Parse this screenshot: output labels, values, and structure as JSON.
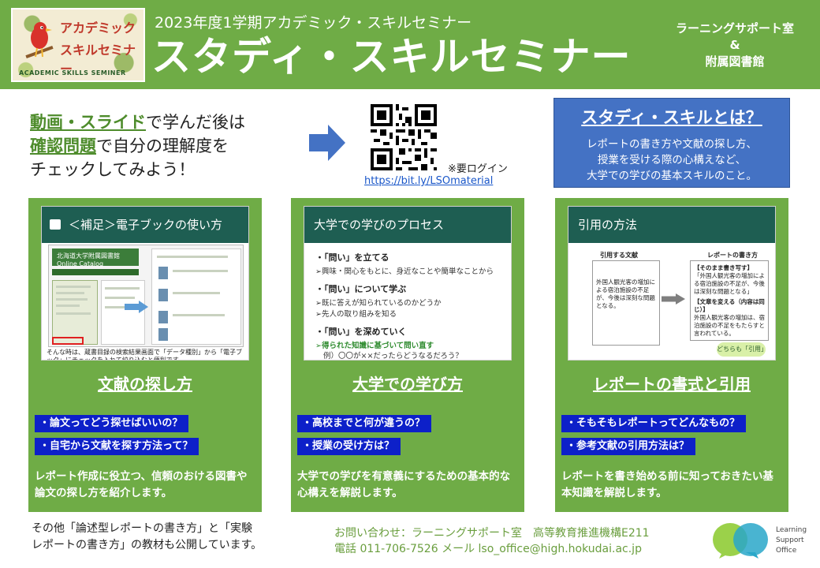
{
  "header": {
    "logo": {
      "line1": "アカデミック",
      "line2": "スキルセミナー",
      "line3": "ACADEMIC SKILLS SEMINER"
    },
    "subtitle": "2023年度1学期アカデミック・スキルセミナー",
    "title": "スタディ・スキルセミナー",
    "org_line1": "ラーニングサポート室",
    "org_line2": "&",
    "org_line3": "附属図書館"
  },
  "intro": {
    "l1_hl": "動画・スライド",
    "l1_rest": "で学んだ後は",
    "l2_hl": "確認問題",
    "l2_rest": "で自分の理解度を",
    "l3": "チェックしてみよう！"
  },
  "qr": {
    "note": "※要ログイン",
    "url": "https://bit.ly/LSOmaterial"
  },
  "what": {
    "title": "スタディ・スキルとは？",
    "line1": "レポートの書き方や文献の探し方、",
    "line2": "授業を受ける際の心構えなど、",
    "line3": "大学での学びの基本スキルのこと。"
  },
  "cards": [
    {
      "slide_title": "＜補足＞電子ブックの使い方",
      "slide_lib": "北海道大学附属図書館 Online Catalog",
      "slide_caption": "そんな時は、蔵書目録の検索結果画面で「データ種別」から「電子ブック」にチェックを入れて絞り込むと便利です。",
      "title": "文献の探し方",
      "q1": "・論文ってどう探せばいいの？",
      "q2": "・自宅から文献を探す方法って？",
      "desc": "レポート作成に役立つ、信頼のおける図書や論文の探し方を紹介します。"
    },
    {
      "slide_title": "大学での学びのプロセス",
      "slide_items": [
        "・「問い」を立てる",
        "➢興味・関心をもとに、身近なことや簡単なことから",
        "・「問い」について学ぶ",
        "➢既に答えが知られているのかどうか",
        "➢先人の取り組みを知る",
        "・「問い」を深めていく",
        "➢得られた知識に基づいて問い直す",
        "例）〇〇が××だったらどうなるだろう？"
      ],
      "title": "大学での学び方",
      "q1": "・高校までと何が違うの？",
      "q2": "・授業の受け方は？",
      "desc": "大学での学びを有意義にするための基本的な心構えを解説します。"
    },
    {
      "slide_title": "引用の方法",
      "slide_col1": "引用する文献",
      "slide_col2": "レポートの書き方",
      "slide_src": "外国人観光客の増加による宿泊施設の不足が、今後は深刻な問題となる。",
      "slide_dst_h1": "【そのまま書き写す】",
      "slide_dst_t1": "「外国人観光客の増加による宿泊施設の不足が、今後は深刻な問題となる」",
      "slide_dst_h2": "【文章を変える（内容は同じ）】",
      "slide_dst_t2": "外国人観光客の増加は、宿泊施設の不足をもたらすと言われている。",
      "slide_bubble": "どちらも「引用」",
      "title": "レポートの書式と引用",
      "q1": "・そもそもレポートってどんなもの？",
      "q2": "・参考文献の引用方法は？",
      "desc": "レポートを書き始める前に知っておきたい基本知識を解説します。"
    }
  ],
  "footer": {
    "note1": "その他「論述型レポートの書き方」と「実験",
    "note2": "レポートの書き方」の教材も公開しています。",
    "contact1": "お問い合わせ：ラーニングサポート室　高等教育推進機構E211",
    "contact2": "電話 011-706-7526 メール lso_office@high.hokudai.ac.jp",
    "lso1": "Learning",
    "lso2": "Support",
    "lso3": "Office"
  },
  "colors": {
    "green": "#6fac46",
    "blue_box": "#4472c4",
    "question_blue": "#0d20c9",
    "slide_bar": "#1e5e52"
  },
  "icons": [
    "arrow-right-icon",
    "qr-code-icon",
    "book-icon",
    "lso-logo-icon"
  ]
}
